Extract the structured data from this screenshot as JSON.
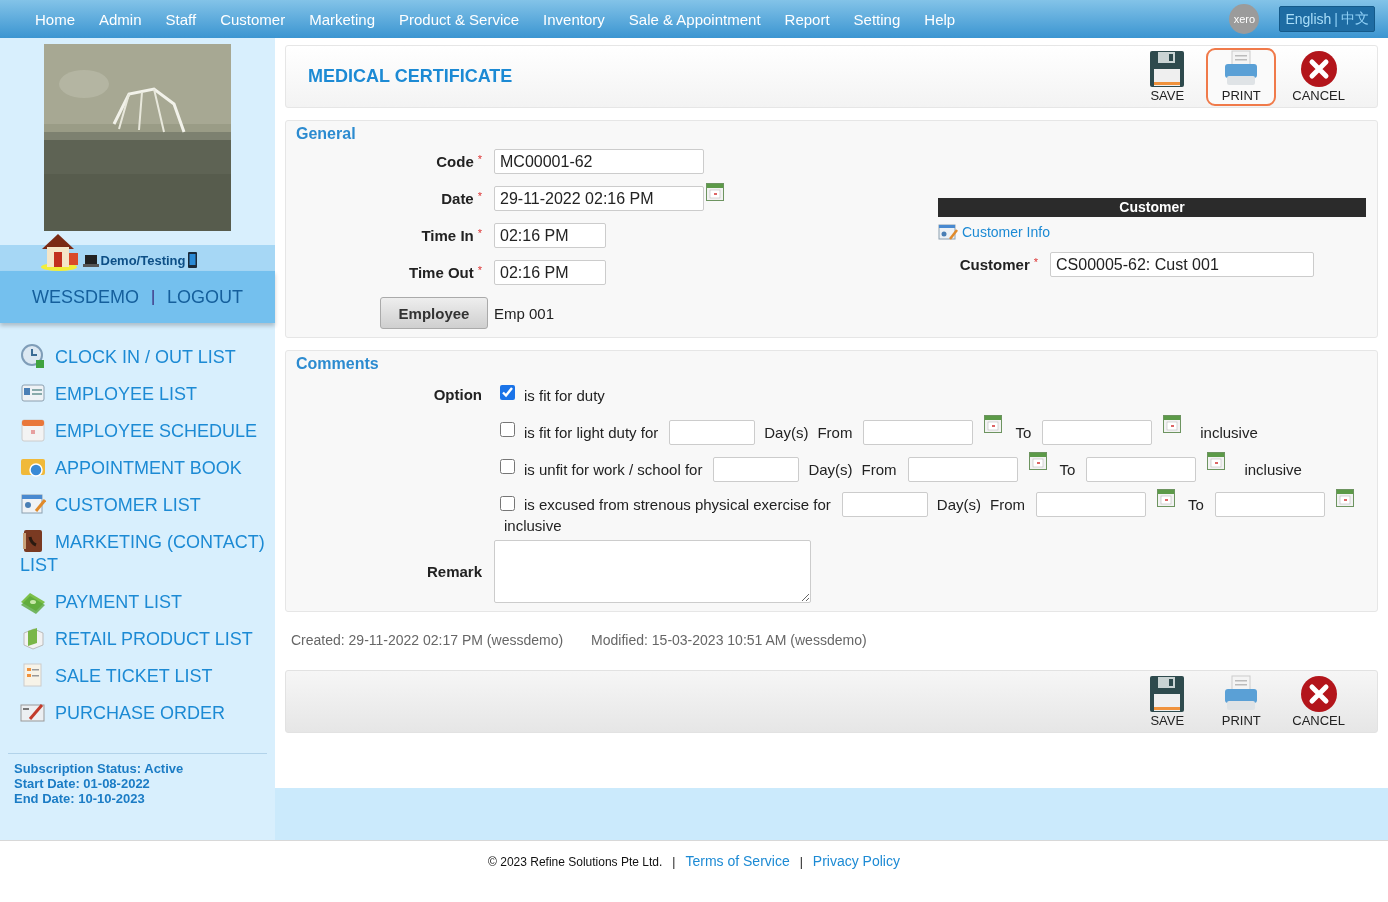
{
  "nav": {
    "items": [
      {
        "label": "Home"
      },
      {
        "label": "Admin"
      },
      {
        "label": "Staff"
      },
      {
        "label": "Customer"
      },
      {
        "label": "Marketing"
      },
      {
        "label": "Product & Service"
      },
      {
        "label": "Inventory"
      },
      {
        "label": "Sale & Appointment"
      },
      {
        "label": "Report"
      },
      {
        "label": "Setting"
      },
      {
        "label": "Help"
      }
    ],
    "xero": "xero",
    "language": {
      "options": [
        {
          "label": "English",
          "selected": true
        },
        {
          "label": "中文",
          "selected": false
        }
      ],
      "separator": "|"
    }
  },
  "sidebar": {
    "profile": {
      "kind": "picture"
    },
    "company": "Demo/Testing",
    "user": "WESSDEMO",
    "separator": "|",
    "logout": "LOGOUT",
    "menu": [
      {
        "label": "CLOCK IN / OUT LIST"
      },
      {
        "label": "EMPLOYEE LIST"
      },
      {
        "label": "EMPLOYEE SCHEDULE"
      },
      {
        "label": "APPOINTMENT BOOK"
      },
      {
        "label": "CUSTOMER LIST"
      },
      {
        "label": "MARKETING (CONTACT) LIST"
      },
      {
        "label": "PAYMENT LIST"
      },
      {
        "label": "RETAIL PRODUCT LIST"
      },
      {
        "label": "SALE TICKET LIST"
      },
      {
        "label": "PURCHASE ORDER"
      }
    ],
    "subscription": [
      "Subscription Status: Active",
      "Start Date: 01-08-2022",
      "End Date: 10-10-2023"
    ]
  },
  "header": {
    "title": "MEDICAL CERTIFICATE",
    "buttons": [
      {
        "kind": "save",
        "label": "SAVE",
        "highlighted": false
      },
      {
        "kind": "print",
        "label": "PRINT",
        "highlighted": true
      },
      {
        "kind": "cancel",
        "label": "CANCEL",
        "highlighted": false
      }
    ]
  },
  "general": {
    "legend": "General",
    "required_mark": "*",
    "fields": [
      {
        "kind": "text",
        "label": "Code",
        "value": "MC00001-62",
        "required": true
      },
      {
        "kind": "date",
        "label": "Date",
        "value": "29-11-2022 02:16 PM",
        "required": true
      },
      {
        "kind": "time",
        "label": "Time In",
        "value": "02:16 PM",
        "required": true
      },
      {
        "kind": "time",
        "label": "Time Out",
        "value": "02:16 PM",
        "required": true
      }
    ],
    "employee": {
      "button": "Employee",
      "value": "Emp 001"
    },
    "customer": {
      "heading": "Customer",
      "link": "Customer Info",
      "label": "Customer",
      "required": true,
      "value": "CS00005-62: Cust 001"
    }
  },
  "comments": {
    "legend": "Comments",
    "option_label": "Option",
    "options": [
      {
        "kind": "simple",
        "label": "is fit for duty",
        "checked": true
      },
      {
        "kind": "period",
        "label": "is fit for light duty for",
        "checked": false,
        "days": "Day(s)",
        "from": "From",
        "to": "To",
        "suffix": "inclusive"
      },
      {
        "kind": "period",
        "label": "is unfit for work / school for",
        "checked": false,
        "days": "Day(s)",
        "from": "From",
        "to": "To",
        "suffix": "inclusive"
      },
      {
        "kind": "period",
        "label": "is excused from strenous physical exercise for",
        "checked": false,
        "days": "Day(s)",
        "from": "From",
        "to": "To",
        "suffix": "inclusive"
      }
    ],
    "remark_label": "Remark"
  },
  "audit": {
    "created": "Created: 29-11-2022 02:17 PM (wessdemo)",
    "modified": "Modified: 15-03-2023 10:51 AM (wessdemo)"
  },
  "footer_toolbar": {
    "buttons": [
      {
        "kind": "save",
        "label": "SAVE",
        "highlighted": false
      },
      {
        "kind": "print",
        "label": "PRINT",
        "highlighted": false
      },
      {
        "kind": "cancel",
        "label": "CANCEL",
        "highlighted": false
      }
    ]
  },
  "footer": {
    "items": [
      {
        "kind": "text",
        "text": "© 2023 Refine Solutions Pte Ltd."
      },
      {
        "kind": "separator",
        "text": "|"
      },
      {
        "kind": "link",
        "text": "Terms of Service"
      },
      {
        "kind": "separator",
        "text": "|"
      },
      {
        "kind": "link",
        "text": "Privacy Policy"
      }
    ]
  }
}
